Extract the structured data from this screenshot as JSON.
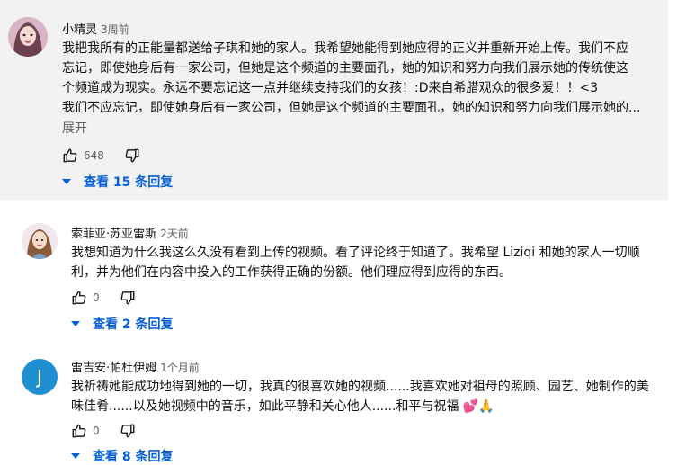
{
  "comments": [
    {
      "author": "小精灵",
      "time": "3周前",
      "lines": [
        "我把我所有的正能量都送给子琪和她的家人。我希望她能得到她应得的正义并重新开始上传。我们不应",
        "忘记，即使她身后有一家公司，但她是这个频道的主要面孔，她的知识和努力向我们展示她的传统使这",
        "个频道成为现实。永远不要忘记这一点并继续支持我们的女孩！:D来自希腊观众的很多爱！！<3",
        "我们不应忘记，即使她身后有一家公司，但她是这个频道的主要面孔，她的知识和努力向我们展示她的..."
      ],
      "expand_label": "展开",
      "likes": "648",
      "replies_label": "查看 15 条回复"
    },
    {
      "author": "索菲亚·苏亚雷斯",
      "time": "2天前",
      "lines": [
        "我想知道为什么我这么久没有看到上传的视频。看了评论终于知道了。我希望 Liziqi 和她的家人一切顺",
        "利，并为他们在内容中投入的工作获得正确的份额。他们理应得到应得的东西。"
      ],
      "likes": "0",
      "replies_label": "查看 2 条回复"
    },
    {
      "author": "雷吉安·帕杜伊姆",
      "time": "1个月前",
      "avatar_letter": "J",
      "lines": [
        "我祈祷她能成功地得到她的一切，我真的很喜欢她的视频......我喜欢她对祖母的照顾、园艺、她制作的美",
        "味佳肴......以及她视频中的音乐，如此平静和关心他人......和平与祝福"
      ],
      "emojis": "💕🙏",
      "likes": "0",
      "replies_label": "查看 8 条回复"
    }
  ],
  "icons": {
    "like": "thumbs-up-icon",
    "dislike": "thumbs-down-icon",
    "expand_replies": "chevron-down-icon"
  },
  "colors": {
    "link": "#065fd4",
    "secondary": "#606060",
    "highlight_bg": "#f2f2f2",
    "avatar_j": "#1e8fd0"
  }
}
